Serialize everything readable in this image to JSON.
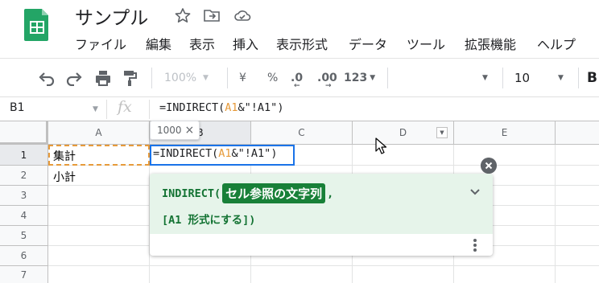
{
  "document": {
    "title": "サンプル"
  },
  "header_icons": [
    "star-icon",
    "move-to-folder-icon",
    "cloud-saved-icon"
  ],
  "menu": [
    "ファイル",
    "編集",
    "表示",
    "挿入",
    "表示形式",
    "データ",
    "ツール",
    "拡張機能",
    "ヘルプ"
  ],
  "toolbar": {
    "zoom": "100%",
    "currency": "¥",
    "percent": "%",
    "decrease_decimal": ".0",
    "increase_decimal": ".00",
    "more_formats": "123",
    "font_size": "10",
    "bold": "B"
  },
  "formula_bar": {
    "cell_ref": "B1",
    "fx": "fx",
    "formula_prefix": "=INDIRECT(",
    "formula_ref": "A1",
    "formula_suffix": "&\"!A1\")"
  },
  "grid": {
    "columns": [
      "A",
      "B",
      "C",
      "D",
      "E"
    ],
    "rows": [
      "1",
      "2",
      "3",
      "4",
      "5",
      "6",
      "7"
    ],
    "cells": {
      "A1": "集計",
      "A2": "小計"
    },
    "active_cell": "B1"
  },
  "size_tooltip": {
    "value": "1000",
    "close": "×"
  },
  "formula_help": {
    "function": "INDIRECT(",
    "param": "セル参照の文字列",
    "comma": ",",
    "optional_open": "[A1 ",
    "optional_text": "形式にする",
    "optional_close": "])"
  },
  "colors": {
    "sheets_green": "#23a566",
    "accent_blue": "#1a73e8",
    "help_green": "#188038",
    "reference_orange": "#e69a3a"
  }
}
